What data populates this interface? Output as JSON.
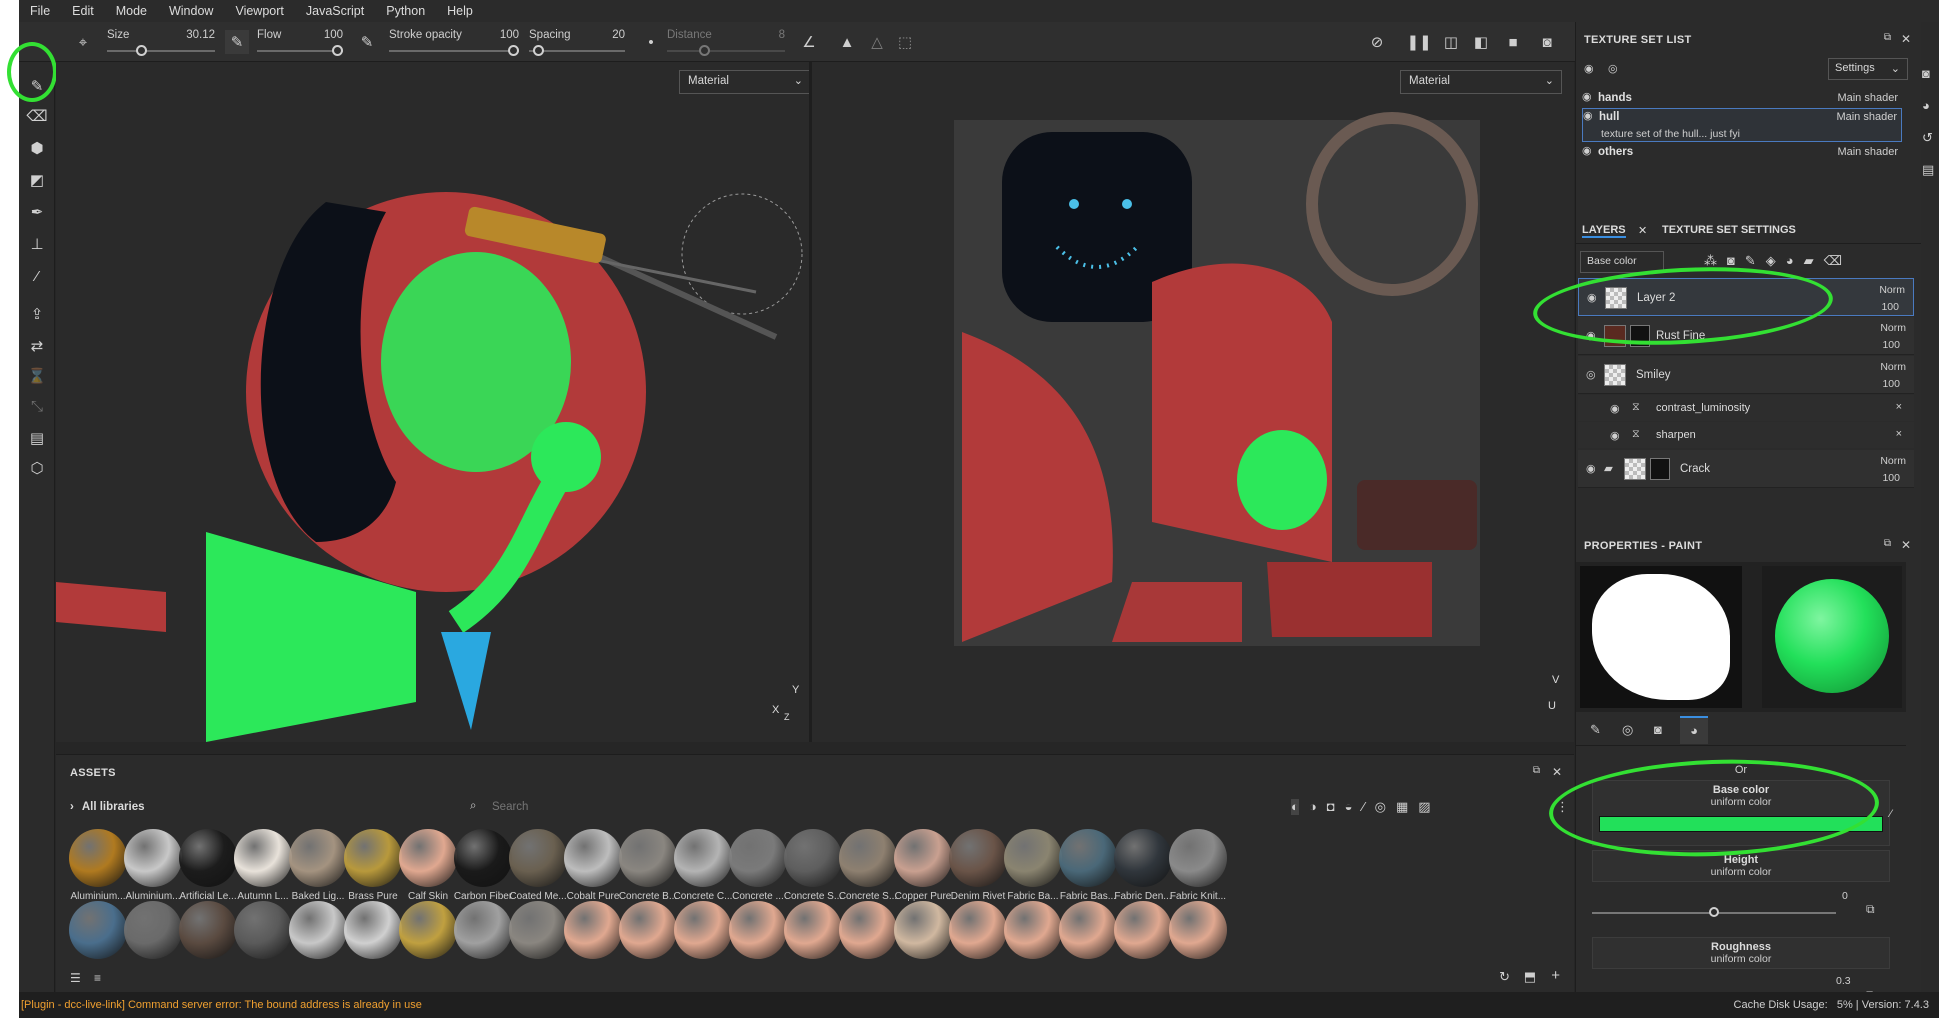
{
  "menu": [
    "File",
    "Edit",
    "Mode",
    "Window",
    "Viewport",
    "JavaScript",
    "Python",
    "Help"
  ],
  "toolbar": {
    "size_label": "Size",
    "size_value": "30.12",
    "size_level": 0.3,
    "flow_label": "Flow",
    "flow_value": "100",
    "flow_level": 1.0,
    "stroke_opacity_label": "Stroke opacity",
    "stroke_opacity_value": "100",
    "stroke_opacity_level": 1.0,
    "spacing_label": "Spacing",
    "spacing_value": "20",
    "spacing_level": 0.05,
    "distance_label": "Distance",
    "distance_value": "8",
    "distance_level": 0.3
  },
  "viewports": {
    "left_mode": "Material",
    "right_mode": "Material",
    "axis_left_x": "X",
    "axis_left_y": "Y",
    "axis_left_z": "Z",
    "axis_right_u": "U",
    "axis_right_v": "V"
  },
  "assets": {
    "title": "ASSETS",
    "all_libraries": "All libraries",
    "search_placeholder": "Search",
    "row1": [
      {
        "name": "Aluminium...",
        "color": "#b07a20"
      },
      {
        "name": "Aluminium...",
        "color": "#c8c8c8"
      },
      {
        "name": "Artificial Le...",
        "color": "#1c1c1c"
      },
      {
        "name": "Autumn L...",
        "color": "#e8e2da"
      },
      {
        "name": "Baked Lig...",
        "color": "#a49380"
      },
      {
        "name": "Brass Pure",
        "color": "#b8993c"
      },
      {
        "name": "Calf Skin",
        "color": "#e0a890"
      },
      {
        "name": "Carbon Fiber",
        "color": "#1a1a1a"
      },
      {
        "name": "Coated Me...",
        "color": "#6a6050"
      },
      {
        "name": "Cobalt Pure",
        "color": "#bdbdbd"
      },
      {
        "name": "Concrete B...",
        "color": "#8a8680"
      },
      {
        "name": "Concrete C...",
        "color": "#b4b4b4"
      },
      {
        "name": "Concrete ...",
        "color": "#7a7a7a"
      },
      {
        "name": "Concrete S...",
        "color": "#5e5e5e"
      },
      {
        "name": "Concrete S...",
        "color": "#8e8070"
      },
      {
        "name": "Copper Pure",
        "color": "#c9a090"
      },
      {
        "name": "Denim Rivet",
        "color": "#6a5448"
      },
      {
        "name": "Fabric Ba...",
        "color": "#8a8470"
      },
      {
        "name": "Fabric Bas...",
        "color": "#4a6878"
      },
      {
        "name": "Fabric Den...",
        "color": "#30363c"
      },
      {
        "name": "Fabric Knit...",
        "color": "#8a8a8a"
      }
    ],
    "row2": [
      {
        "color": "#4a6e8c"
      },
      {
        "color": "#6a6a6a"
      },
      {
        "color": "#5a4a40"
      },
      {
        "color": "#5a5a5a"
      },
      {
        "color": "#c8c8c8"
      },
      {
        "color": "#d0d0d0"
      },
      {
        "color": "#c0a040"
      },
      {
        "color": "#a0a0a0"
      },
      {
        "color": "#8a8680"
      },
      {
        "color": "#e0a890"
      },
      {
        "color": "#e0a890"
      },
      {
        "color": "#e0a890"
      },
      {
        "color": "#e0a890"
      },
      {
        "color": "#e0a890"
      },
      {
        "color": "#e0a890"
      },
      {
        "color": "#d0b8a0"
      },
      {
        "color": "#e0a890"
      },
      {
        "color": "#e0a890"
      },
      {
        "color": "#e0a890"
      },
      {
        "color": "#e0a890"
      },
      {
        "color": "#e0a890"
      }
    ]
  },
  "texture_set_list": {
    "title": "TEXTURE SET LIST",
    "settings_label": "Settings",
    "sets": [
      {
        "name": "hands",
        "shader": "Main shader"
      },
      {
        "name": "hull",
        "shader": "Main shader",
        "description": "texture set of the hull... just fyi"
      },
      {
        "name": "others",
        "shader": "Main shader"
      }
    ]
  },
  "layers": {
    "tab_layers": "LAYERS",
    "tab_settings": "TEXTURE SET SETTINGS",
    "channel": "Base color",
    "items": [
      {
        "name": "Layer 2",
        "blend": "Norm",
        "opacity": "100"
      },
      {
        "name": "Rust Fine",
        "blend": "Norm",
        "opacity": "100"
      },
      {
        "name": "Smiley",
        "blend": "Norm",
        "opacity": "100"
      },
      {
        "name": "contrast_luminosity"
      },
      {
        "name": "sharpen"
      },
      {
        "name": "Crack",
        "blend": "Norm",
        "opacity": "100"
      }
    ]
  },
  "properties": {
    "title": "PROPERTIES - PAINT",
    "or_label": "Or",
    "base_color_label": "Base color",
    "base_color_sub": "uniform color",
    "base_color_value": "#22e05a",
    "height_label": "Height",
    "height_sub": "uniform color",
    "height_value": "0",
    "height_level": 0.5,
    "roughness_label": "Roughness",
    "roughness_sub": "uniform color",
    "roughness_value": "0.3",
    "roughness_level": 0.3
  },
  "status": {
    "error": "[Plugin - dcc-live-link] Command server error: The bound address is already in use",
    "right": "Cache Disk Usage:   5% | Version: 7.4.3"
  }
}
